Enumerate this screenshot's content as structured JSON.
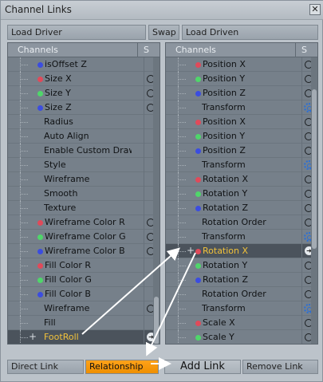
{
  "window": {
    "title": "Channel Links",
    "close_icon": "close-icon"
  },
  "toolbar": {
    "load_driver": "Load Driver",
    "swap": "Swap",
    "load_driven": "Load Driven"
  },
  "left_panel": {
    "header": {
      "channels": "Channels",
      "s": "S"
    },
    "rows": [
      {
        "label": "isOffset Z",
        "dot": "#3b4de0",
        "circle": false
      },
      {
        "label": "Size X",
        "dot": "#e04a5a",
        "circle": true
      },
      {
        "label": "Size Y",
        "dot": "#4fd66a",
        "circle": true
      },
      {
        "label": "Size Z",
        "dot": "#3b4de0",
        "circle": true
      },
      {
        "label": "Radius",
        "dot": "",
        "circle": false
      },
      {
        "label": "Auto Align",
        "dot": "",
        "circle": false
      },
      {
        "label": "Enable Custom Draw…",
        "dot": "",
        "circle": false
      },
      {
        "label": "Style",
        "dot": "",
        "circle": false
      },
      {
        "label": "Wireframe",
        "dot": "",
        "circle": false
      },
      {
        "label": "Smooth",
        "dot": "",
        "circle": false
      },
      {
        "label": "Texture",
        "dot": "",
        "circle": false
      },
      {
        "label": "Wireframe Color R",
        "dot": "#e04a5a",
        "circle": true
      },
      {
        "label": "Wireframe Color G",
        "dot": "#4fd66a",
        "circle": true
      },
      {
        "label": "Wireframe Color B",
        "dot": "#3b4de0",
        "circle": true
      },
      {
        "label": "Fill Color R",
        "dot": "#e04a5a",
        "circle": false
      },
      {
        "label": "Fill Color G",
        "dot": "#4fd66a",
        "circle": false
      },
      {
        "label": "Fill Color B",
        "dot": "#3b4de0",
        "circle": false
      },
      {
        "label": "Wireframe",
        "dot": "",
        "circle": true
      },
      {
        "label": "Fill",
        "dot": "",
        "circle": false
      }
    ],
    "selected": {
      "label": "FootRoll"
    }
  },
  "right_panel": {
    "header": {
      "channels": "Channels",
      "s": "S"
    },
    "rows": [
      {
        "label": "Position X",
        "dot": "#e04a5a",
        "mark": "circle"
      },
      {
        "label": "Position Y",
        "dot": "#4fd66a",
        "mark": "circle"
      },
      {
        "label": "Position Z",
        "dot": "#3b4de0",
        "mark": "circle"
      },
      {
        "label": "Transform",
        "dot": "",
        "mark": "gear"
      },
      {
        "label": "Position X",
        "dot": "#e04a5a",
        "mark": "circle"
      },
      {
        "label": "Position Y",
        "dot": "#4fd66a",
        "mark": "circle"
      },
      {
        "label": "Position Z",
        "dot": "#3b4de0",
        "mark": "circle"
      },
      {
        "label": "Transform",
        "dot": "",
        "mark": "gear"
      },
      {
        "label": "Rotation X",
        "dot": "#e04a5a",
        "mark": "circle"
      },
      {
        "label": "Rotation Y",
        "dot": "#4fd66a",
        "mark": "circle"
      },
      {
        "label": "Rotation Z",
        "dot": "#3b4de0",
        "mark": "circle"
      },
      {
        "label": "Rotation Order",
        "dot": "",
        "mark": "circle"
      },
      {
        "label": "Transform",
        "dot": "",
        "mark": "gear"
      },
      {
        "label": "Rotation X",
        "dot": "#e04a5a",
        "mark": "arrow",
        "selected": true
      },
      {
        "label": "Rotation Y",
        "dot": "#4fd66a",
        "mark": "circle"
      },
      {
        "label": "Rotation Z",
        "dot": "#3b4de0",
        "mark": "circle"
      },
      {
        "label": "Rotation Order",
        "dot": "",
        "mark": "circle"
      },
      {
        "label": "Transform",
        "dot": "",
        "mark": "gear"
      },
      {
        "label": "Scale X",
        "dot": "#e04a5a",
        "mark": "circle"
      },
      {
        "label": "Scale Y",
        "dot": "#4fd66a",
        "mark": "circle"
      }
    ]
  },
  "bottom": {
    "direct_link": "Direct Link",
    "relationship": "Relationship",
    "add_link": "Add Link",
    "remove_link": "Remove Link"
  },
  "colors": {
    "accent": "#f89a0c",
    "selected_text": "#f2c23a"
  }
}
